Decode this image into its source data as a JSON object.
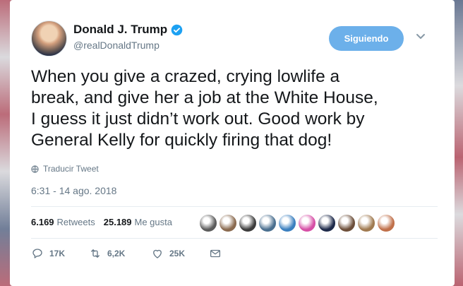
{
  "author": {
    "name": "Donald J. Trump",
    "handle": "@realDonaldTrump",
    "verified": true
  },
  "follow_button": {
    "label": "Siguiendo",
    "color": "#6cb0ea"
  },
  "tweet": {
    "lines": [
      "When you give a crazed, crying lowlife a",
      "break, and give her a job at the White House,",
      "I guess it just didn’t work out. Good work by",
      "General Kelly for quickly firing that dog!"
    ]
  },
  "translate_label": "Traducir Tweet",
  "timestamp": "6:31 - 14 ago. 2018",
  "stats": {
    "retweets_count": "6.169",
    "retweets_label": "Retweets",
    "likes_count": "25.189",
    "likes_label": "Me gusta"
  },
  "likers": [
    {
      "color": "#5b5b5b"
    },
    {
      "color": "#8a6a4f"
    },
    {
      "color": "#3c3c3c"
    },
    {
      "color": "#4a6f8f"
    },
    {
      "color": "#3a7fbf"
    },
    {
      "color": "#d64fa6"
    },
    {
      "color": "#1e2a4a"
    },
    {
      "color": "#6d4f3a"
    },
    {
      "color": "#a07a50"
    },
    {
      "color": "#c0704a"
    }
  ],
  "actions": {
    "replies": "17K",
    "retweets": "6,2K",
    "likes": "25K"
  },
  "colors": {
    "verified_blue": "#1da1f2",
    "secondary_text": "#657786",
    "primary_text": "#14171a"
  }
}
